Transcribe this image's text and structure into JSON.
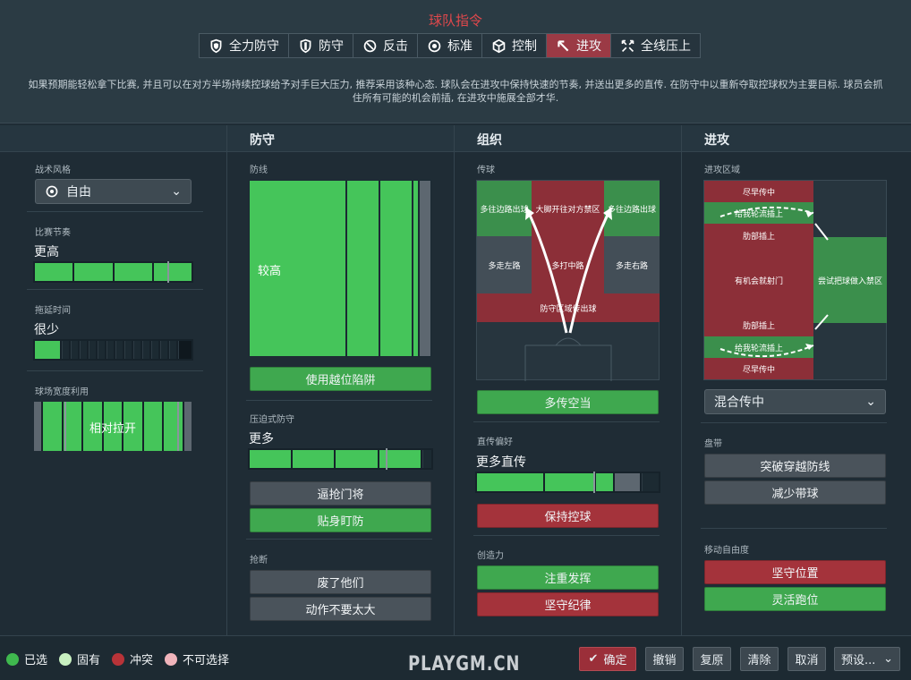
{
  "title": "球队指令",
  "mentality": [
    {
      "label": "全力防守",
      "icon": "shield-double-icon",
      "selected": false
    },
    {
      "label": "防守",
      "icon": "shield-icon",
      "selected": false
    },
    {
      "label": "反击",
      "icon": "counter-icon",
      "selected": false
    },
    {
      "label": "标准",
      "icon": "balance-icon",
      "selected": false
    },
    {
      "label": "控制",
      "icon": "cube-icon",
      "selected": false
    },
    {
      "label": "进攻",
      "icon": "arrow-icon",
      "selected": true
    },
    {
      "label": "全线压上",
      "icon": "arrows-out-icon",
      "selected": false
    }
  ],
  "description": "如果预期能轻松拿下比赛, 并且可以在对方半场持续控球给予对手巨大压力, 推荐采用该种心态. 球队会在进攻中保持快速的节奏, 并送出更多的直传. 在防守中以重新夺取控球权为主要目标. 球员会抓住所有可能的机会前插, 在进攻中施展全部才华.",
  "general": {
    "style_label": "战术风格",
    "style_value": "自由",
    "tempo_label": "比赛节奏",
    "tempo_value": "更高",
    "tempo_level": 0.85,
    "timewasting_label": "拖延时间",
    "timewasting_value": "很少",
    "timewasting_level": 0.17,
    "width_label": "球场宽度利用",
    "width_value": "相对拉开"
  },
  "defence": {
    "header": "防守",
    "line_label": "防线",
    "line_value": "较高",
    "offside_trap": "使用越位陷阱",
    "pressing_label": "压迫式防守",
    "pressing_value": "更多",
    "pressing_level": 0.85,
    "btn_keeper": "逼抢门将",
    "btn_tight": "贴身盯防",
    "tackling_label": "抢断",
    "btn_getstuck": "废了他们",
    "btn_stay": "动作不要太大"
  },
  "buildup": {
    "header": "组织",
    "passing_label": "传球",
    "zones": {
      "flank_l": "多往边路出球",
      "long": "大脚开往对方禁区",
      "flank_r": "多往边路出球",
      "left": "多走左路",
      "middle": "多打中路",
      "right": "多走右路",
      "defence": "防守区域传出球"
    },
    "btn_space": "多传空当",
    "directness_label": "直传偏好",
    "directness_value": "更多直传",
    "directness_level": 0.75,
    "btn_possession": "保持控球",
    "creative_label": "创造力",
    "btn_express": "注重发挥",
    "btn_discipline": "坚守纪律"
  },
  "attack": {
    "header": "进攻",
    "zone_label": "进攻区域",
    "zones": {
      "early_top": "尽早传中",
      "overlap_top": "给我轮流插上",
      "underlap_top": "肋部插上",
      "shoot": "有机会就射门",
      "workball": "尝试把球做入禁区",
      "underlap_bot": "肋部插上",
      "overlap_bot": "给我轮流插上",
      "early_bot": "尽早传中"
    },
    "cross_value": "混合传中",
    "dribble_label": "盘带",
    "btn_dribble_more": "突破穿越防线",
    "btn_dribble_less": "减少带球",
    "freedom_label": "移动自由度",
    "btn_hold": "坚守位置",
    "btn_roam": "灵活跑位"
  },
  "legend": [
    {
      "label": "已选",
      "color": "#3fb84e"
    },
    {
      "label": "固有",
      "color": "#c8f0c0"
    },
    {
      "label": "冲突",
      "color": "#b83338"
    },
    {
      "label": "不可选择",
      "color": "#f0b4bb"
    }
  ],
  "watermark": "PLAYGM.CN",
  "footer": {
    "confirm": "确定",
    "undo": "撤销",
    "redo": "复原",
    "clear": "清除",
    "cancel": "取消",
    "preset": "预设..."
  }
}
